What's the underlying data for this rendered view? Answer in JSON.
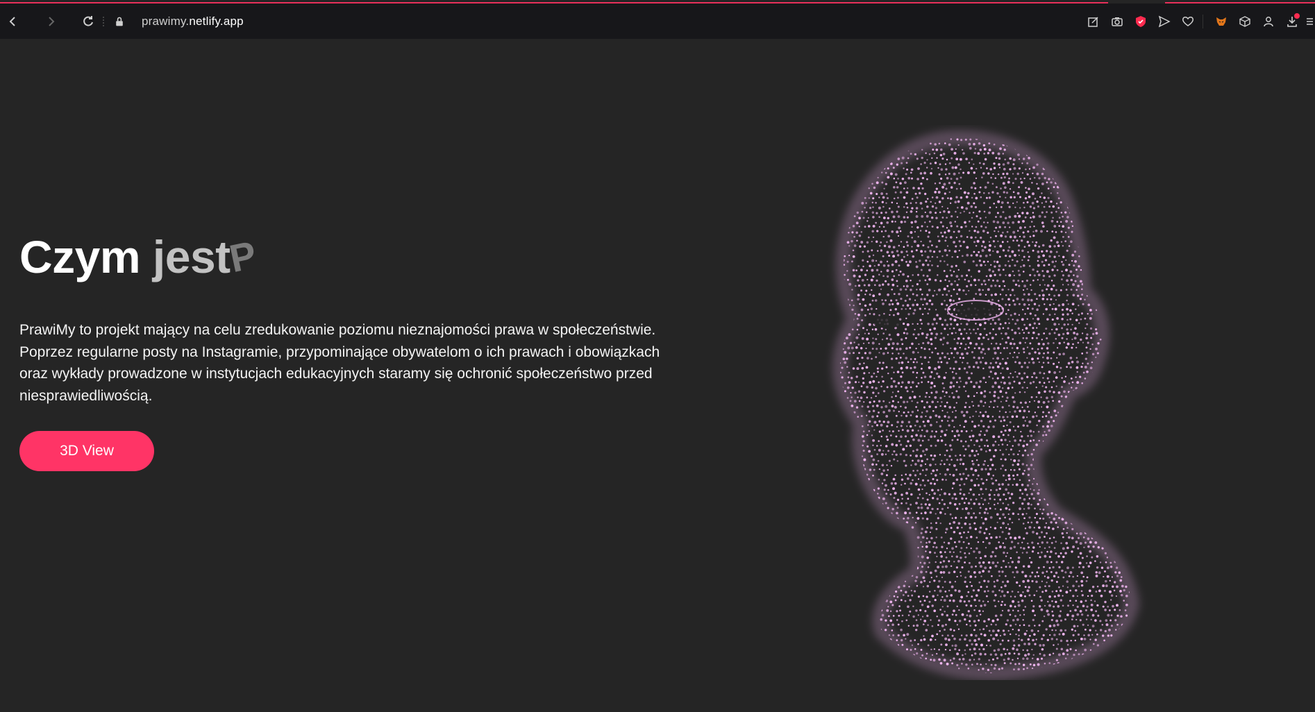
{
  "browser": {
    "url_prefix": "prawimy.",
    "url_host": "netlify.app",
    "accent": "#e8305a",
    "toolbar_icons": [
      "edit-icon",
      "camera-icon",
      "shield-icon",
      "send-icon",
      "heart-icon",
      "fox-extension-icon",
      "cube-icon",
      "profile-icon",
      "download-icon",
      "menu-icon"
    ]
  },
  "hero": {
    "title_word1": "Czym",
    "title_word2": "jest",
    "title_word3": "P",
    "description": "PrawiMy to projekt mający na celu zredukowanie poziomu nieznajomości prawa w społeczeństwie. Poprzez regularne posty na Instagramie, przypominające obywatelom o ich prawach i obowiązkach oraz wykłady prowadzone w instytucjach edukacyjnych staramy się ochronić społeczeństwo przed niesprawiedliwością.",
    "cta_label": "3D View",
    "cta_color": "#ff3466",
    "dot_color": "#f4b8f4"
  }
}
